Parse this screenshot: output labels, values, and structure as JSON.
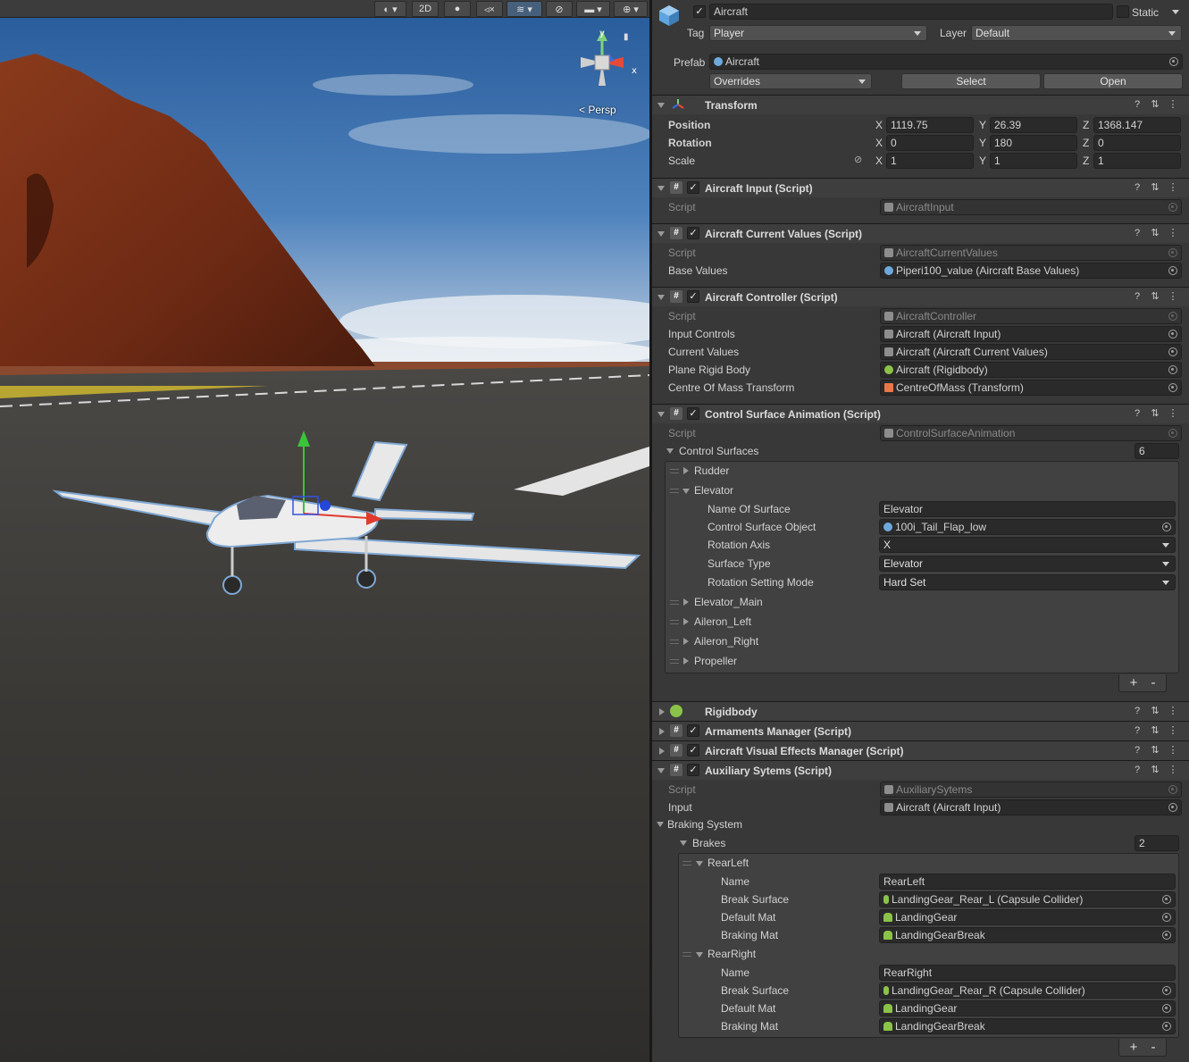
{
  "scene": {
    "toolbar": {
      "mode_2d": "2D"
    },
    "persp": "Persp",
    "gizmo_axes": {
      "y": "y",
      "x": "x"
    }
  },
  "inspector": {
    "object_name": "Aircraft",
    "static_label": "Static",
    "tag_label": "Tag",
    "tag_value": "Player",
    "layer_label": "Layer",
    "layer_value": "Default",
    "prefab_label": "Prefab",
    "prefab_value": "Aircraft",
    "overrides": "Overrides",
    "select": "Select",
    "open": "Open",
    "transform": {
      "title": "Transform",
      "position_label": "Position",
      "rotation_label": "Rotation",
      "scale_label": "Scale",
      "axis_x": "X",
      "axis_y": "Y",
      "axis_z": "Z",
      "position": {
        "x": "1119.75",
        "y": "26.39",
        "z": "1368.147"
      },
      "rotation": {
        "x": "0",
        "y": "180",
        "z": "0"
      },
      "scale": {
        "x": "1",
        "y": "1",
        "z": "1"
      }
    },
    "aircraft_input": {
      "title": "Aircraft Input (Script)",
      "script_label": "Script",
      "script_value": "AircraftInput"
    },
    "current_values": {
      "title": "Aircraft Current Values (Script)",
      "script_label": "Script",
      "script_value": "AircraftCurrentValues",
      "base_label": "Base Values",
      "base_value": "Piperi100_value (Aircraft Base Values)"
    },
    "controller": {
      "title": "Aircraft Controller (Script)",
      "script_label": "Script",
      "script_value": "AircraftController",
      "input_label": "Input Controls",
      "input_value": "Aircraft (Aircraft Input)",
      "current_label": "Current Values",
      "current_value": "Aircraft (Aircraft Current Values)",
      "rb_label": "Plane Rigid Body",
      "rb_value": "Aircraft (Rigidbody)",
      "com_label": "Centre Of Mass Transform",
      "com_value": "CentreOfMass (Transform)"
    },
    "csa": {
      "title": "Control Surface Animation (Script)",
      "script_label": "Script",
      "script_value": "ControlSurfaceAnimation",
      "list_label": "Control Surfaces",
      "list_count": "6",
      "rudder": "Rudder",
      "elevator": "Elevator",
      "name_label": "Name Of Surface",
      "name_value": "Elevator",
      "object_label": "Control Surface Object",
      "object_value": "100i_Tail_Flap_low",
      "axis_label": "Rotation Axis",
      "axis_value": "X",
      "type_label": "Surface Type",
      "type_value": "Elevator",
      "mode_label": "Rotation Setting Mode",
      "mode_value": "Hard Set",
      "elevator_main": "Elevator_Main",
      "aileron_left": "Aileron_Left",
      "aileron_right": "Aileron_Right",
      "propeller": "Propeller",
      "plus": "+",
      "minus": "-"
    },
    "rigidbody": {
      "title": "Rigidbody"
    },
    "armaments": {
      "title": "Armaments Manager (Script)"
    },
    "vfx": {
      "title": "Aircraft Visual Effects Manager (Script)"
    },
    "aux": {
      "title": "Auxiliary Sytems (Script)",
      "script_label": "Script",
      "script_value": "AuxiliarySytems",
      "input_label": "Input",
      "input_value": "Aircraft (Aircraft Input)",
      "braking_label": "Braking System",
      "brakes_label": "Brakes",
      "brakes_count": "2",
      "rear_left": {
        "label": "RearLeft",
        "name_label": "Name",
        "name_value": "RearLeft",
        "surface_label": "Break Surface",
        "surface_value": "LandingGear_Rear_L (Capsule Collider)",
        "default_label": "Default Mat",
        "default_value": "LandingGear",
        "braking_label": "Braking Mat",
        "braking_value": "LandingGearBreak"
      },
      "rear_right": {
        "label": "RearRight",
        "name_label": "Name",
        "name_value": "RearRight",
        "surface_label": "Break Surface",
        "surface_value": "LandingGear_Rear_R (Capsule Collider)",
        "default_label": "Default Mat",
        "default_value": "LandingGear",
        "braking_label": "Braking Mat",
        "braking_value": "LandingGearBreak"
      },
      "plus": "+",
      "minus": "-"
    }
  }
}
